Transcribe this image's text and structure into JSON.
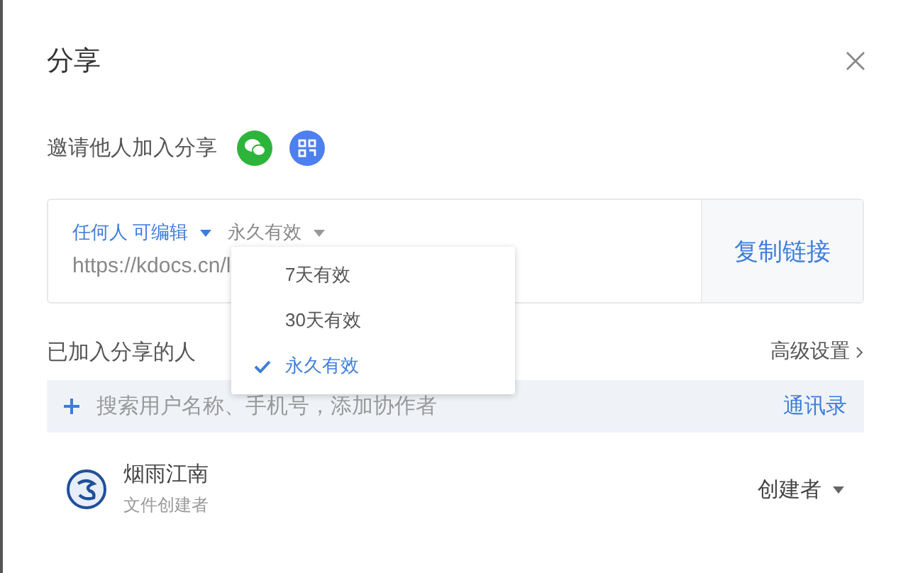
{
  "dialog": {
    "title": "分享"
  },
  "invite": {
    "label": "邀请他人加入分享"
  },
  "link": {
    "permission": "任何人 可编辑",
    "expiry": "永久有效",
    "url": "https://kdocs.cn/l",
    "copy_button": "复制链接"
  },
  "expiry_menu": [
    {
      "label": "7天有效",
      "selected": false
    },
    {
      "label": "30天有效",
      "selected": false
    },
    {
      "label": "永久有效",
      "selected": true
    }
  ],
  "members_section": {
    "title": "已加入分享的人",
    "advanced": "高级设置",
    "search_placeholder": "搜索用户名称、手机号，添加协作者",
    "contacts": "通讯录"
  },
  "members": [
    {
      "name": "烟雨江南",
      "subtitle": "文件创建者",
      "role": "创建者"
    }
  ]
}
